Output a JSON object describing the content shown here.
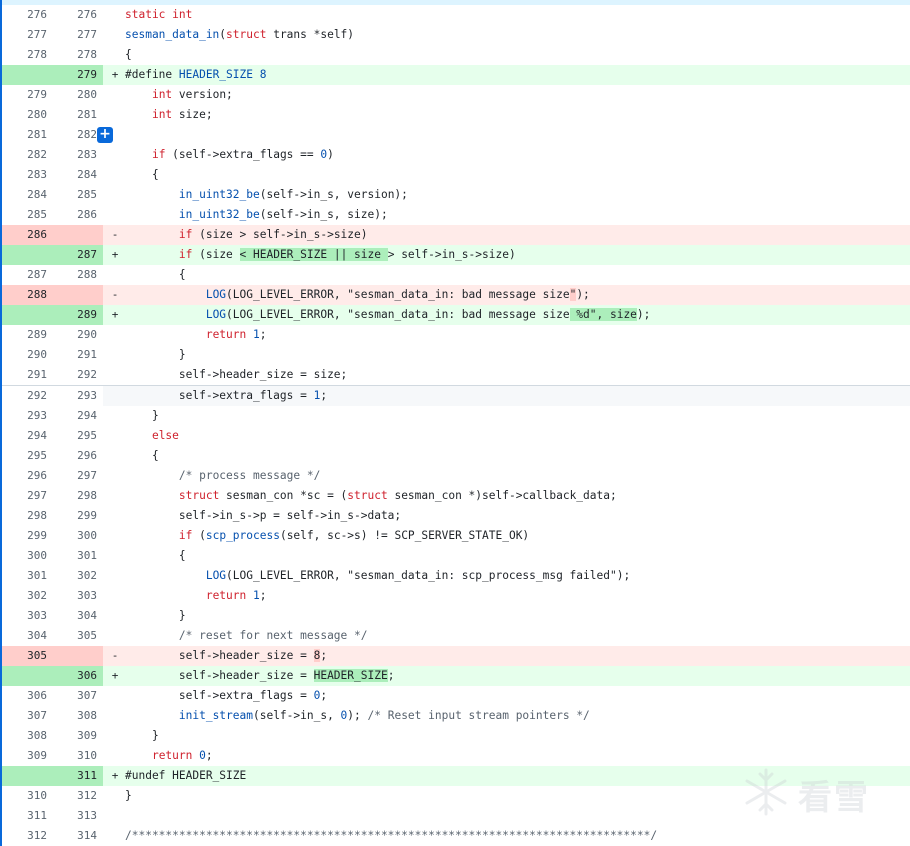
{
  "rows": [
    {
      "old": "276",
      "new": "276",
      "type": "ctx",
      "marker": "",
      "parts": [
        {
          "t": "static int",
          "c": "kw"
        }
      ]
    },
    {
      "old": "277",
      "new": "277",
      "type": "ctx",
      "marker": "",
      "parts": [
        {
          "t": "sesman_data_in",
          "c": "fn"
        },
        {
          "t": "(",
          "c": ""
        },
        {
          "t": "struct",
          "c": "kw"
        },
        {
          "t": " trans *self)",
          "c": ""
        }
      ]
    },
    {
      "old": "278",
      "new": "278",
      "type": "ctx",
      "marker": "",
      "parts": [
        {
          "t": "{",
          "c": ""
        }
      ]
    },
    {
      "old": "",
      "new": "279",
      "type": "add",
      "marker": "+",
      "parts": [
        {
          "t": "#define ",
          "c": ""
        },
        {
          "t": "HEADER_SIZE",
          "c": "fn"
        },
        {
          "t": " ",
          "c": ""
        },
        {
          "t": "8",
          "c": "fn"
        }
      ]
    },
    {
      "old": "279",
      "new": "280",
      "type": "ctx",
      "marker": "",
      "parts": [
        {
          "t": "    ",
          "c": ""
        },
        {
          "t": "int",
          "c": "kw"
        },
        {
          "t": " version;",
          "c": ""
        }
      ]
    },
    {
      "old": "280",
      "new": "281",
      "type": "ctx",
      "marker": "",
      "parts": [
        {
          "t": "    ",
          "c": ""
        },
        {
          "t": "int",
          "c": "kw"
        },
        {
          "t": " size;",
          "c": ""
        }
      ]
    },
    {
      "old": "281",
      "new": "282",
      "type": "ctx",
      "marker": "",
      "expand": true,
      "parts": []
    },
    {
      "old": "282",
      "new": "283",
      "type": "ctx",
      "marker": "",
      "parts": [
        {
          "t": "    ",
          "c": ""
        },
        {
          "t": "if",
          "c": "kw"
        },
        {
          "t": " (self->extra_flags == ",
          "c": ""
        },
        {
          "t": "0",
          "c": "fn"
        },
        {
          "t": ")",
          "c": ""
        }
      ]
    },
    {
      "old": "283",
      "new": "284",
      "type": "ctx",
      "marker": "",
      "parts": [
        {
          "t": "    {",
          "c": ""
        }
      ]
    },
    {
      "old": "284",
      "new": "285",
      "type": "ctx",
      "marker": "",
      "parts": [
        {
          "t": "        ",
          "c": ""
        },
        {
          "t": "in_uint32_be",
          "c": "fn"
        },
        {
          "t": "(self->in_s, version);",
          "c": ""
        }
      ]
    },
    {
      "old": "285",
      "new": "286",
      "type": "ctx",
      "marker": "",
      "parts": [
        {
          "t": "        ",
          "c": ""
        },
        {
          "t": "in_uint32_be",
          "c": "fn"
        },
        {
          "t": "(self->in_s, size);",
          "c": ""
        }
      ]
    },
    {
      "old": "286",
      "new": "",
      "type": "del",
      "marker": "-",
      "parts": [
        {
          "t": "        ",
          "c": ""
        },
        {
          "t": "if",
          "c": "kw"
        },
        {
          "t": " (size > self->in_s->size)",
          "c": ""
        }
      ]
    },
    {
      "old": "",
      "new": "287",
      "type": "add",
      "marker": "+",
      "parts": [
        {
          "t": "        ",
          "c": ""
        },
        {
          "t": "if",
          "c": "kw"
        },
        {
          "t": " (size ",
          "c": ""
        },
        {
          "t": "< HEADER_SIZE || size ",
          "c": "hl-add"
        },
        {
          "t": "> self->in_s->size)",
          "c": ""
        }
      ]
    },
    {
      "old": "287",
      "new": "288",
      "type": "ctx",
      "marker": "",
      "parts": [
        {
          "t": "        {",
          "c": ""
        }
      ]
    },
    {
      "old": "288",
      "new": "",
      "type": "del",
      "marker": "-",
      "parts": [
        {
          "t": "            ",
          "c": ""
        },
        {
          "t": "LOG",
          "c": "fn"
        },
        {
          "t": "(LOG_LEVEL_ERROR, \"sesman_data_in: bad message size",
          "c": ""
        },
        {
          "t": "\"",
          "c": "hl-del"
        },
        {
          "t": ");",
          "c": ""
        }
      ]
    },
    {
      "old": "",
      "new": "289",
      "type": "add",
      "marker": "+",
      "parts": [
        {
          "t": "            ",
          "c": ""
        },
        {
          "t": "LOG",
          "c": "fn"
        },
        {
          "t": "(LOG_LEVEL_ERROR, \"sesman_data_in: bad message size",
          "c": ""
        },
        {
          "t": " %d\", size",
          "c": "hl-add"
        },
        {
          "t": ");",
          "c": ""
        }
      ]
    },
    {
      "old": "289",
      "new": "290",
      "type": "ctx",
      "marker": "",
      "parts": [
        {
          "t": "            ",
          "c": ""
        },
        {
          "t": "return",
          "c": "kw"
        },
        {
          "t": " ",
          "c": ""
        },
        {
          "t": "1",
          "c": "fn"
        },
        {
          "t": ";",
          "c": ""
        }
      ]
    },
    {
      "old": "290",
      "new": "291",
      "type": "ctx",
      "marker": "",
      "parts": [
        {
          "t": "        }",
          "c": ""
        }
      ]
    },
    {
      "old": "291",
      "new": "292",
      "type": "ctx",
      "marker": "",
      "parts": [
        {
          "t": "        self->header_size = size;",
          "c": ""
        }
      ]
    },
    {
      "old": "292",
      "new": "293",
      "type": "gray",
      "sep": true,
      "marker": "",
      "parts": [
        {
          "t": "        self->extra_flags = ",
          "c": ""
        },
        {
          "t": "1",
          "c": "fn"
        },
        {
          "t": ";",
          "c": ""
        }
      ]
    },
    {
      "old": "293",
      "new": "294",
      "type": "ctx",
      "marker": "",
      "parts": [
        {
          "t": "    }",
          "c": ""
        }
      ]
    },
    {
      "old": "294",
      "new": "295",
      "type": "ctx",
      "marker": "",
      "parts": [
        {
          "t": "    ",
          "c": ""
        },
        {
          "t": "else",
          "c": "kw"
        }
      ]
    },
    {
      "old": "295",
      "new": "296",
      "type": "ctx",
      "marker": "",
      "parts": [
        {
          "t": "    {",
          "c": ""
        }
      ]
    },
    {
      "old": "296",
      "new": "297",
      "type": "ctx",
      "marker": "",
      "parts": [
        {
          "t": "        ",
          "c": ""
        },
        {
          "t": "/* process message */",
          "c": "cm"
        }
      ]
    },
    {
      "old": "297",
      "new": "298",
      "type": "ctx",
      "marker": "",
      "parts": [
        {
          "t": "        ",
          "c": ""
        },
        {
          "t": "struct",
          "c": "kw"
        },
        {
          "t": " sesman_con *sc = (",
          "c": ""
        },
        {
          "t": "struct",
          "c": "kw"
        },
        {
          "t": " sesman_con *)self->callback_data;",
          "c": ""
        }
      ]
    },
    {
      "old": "298",
      "new": "299",
      "type": "ctx",
      "marker": "",
      "parts": [
        {
          "t": "        self->in_s->p = self->in_s->data;",
          "c": ""
        }
      ]
    },
    {
      "old": "299",
      "new": "300",
      "type": "ctx",
      "marker": "",
      "parts": [
        {
          "t": "        ",
          "c": ""
        },
        {
          "t": "if",
          "c": "kw"
        },
        {
          "t": " (",
          "c": ""
        },
        {
          "t": "scp_process",
          "c": "fn"
        },
        {
          "t": "(self, sc->s) != SCP_SERVER_STATE_OK)",
          "c": ""
        }
      ]
    },
    {
      "old": "300",
      "new": "301",
      "type": "ctx",
      "marker": "",
      "parts": [
        {
          "t": "        {",
          "c": ""
        }
      ]
    },
    {
      "old": "301",
      "new": "302",
      "type": "ctx",
      "marker": "",
      "parts": [
        {
          "t": "            ",
          "c": ""
        },
        {
          "t": "LOG",
          "c": "fn"
        },
        {
          "t": "(LOG_LEVEL_ERROR, \"sesman_data_in: scp_process_msg failed\");",
          "c": ""
        }
      ]
    },
    {
      "old": "302",
      "new": "303",
      "type": "ctx",
      "sepwhite": true,
      "marker": "",
      "parts": [
        {
          "t": "            ",
          "c": ""
        },
        {
          "t": "return",
          "c": "kw"
        },
        {
          "t": " ",
          "c": ""
        },
        {
          "t": "1",
          "c": "fn"
        },
        {
          "t": ";",
          "c": ""
        }
      ]
    },
    {
      "old": "303",
      "new": "304",
      "type": "ctx",
      "marker": "",
      "parts": [
        {
          "t": "        }",
          "c": ""
        }
      ]
    },
    {
      "old": "304",
      "new": "305",
      "type": "ctx",
      "marker": "",
      "parts": [
        {
          "t": "        ",
          "c": ""
        },
        {
          "t": "/* reset for next message */",
          "c": "cm"
        }
      ]
    },
    {
      "old": "305",
      "new": "",
      "type": "del",
      "marker": "-",
      "parts": [
        {
          "t": "        self->header_size = ",
          "c": ""
        },
        {
          "t": "8",
          "c": "hl-del"
        },
        {
          "t": ";",
          "c": ""
        }
      ]
    },
    {
      "old": "",
      "new": "306",
      "type": "add",
      "marker": "+",
      "parts": [
        {
          "t": "        self->header_size = ",
          "c": ""
        },
        {
          "t": "HEADER_SIZE",
          "c": "hl-add"
        },
        {
          "t": ";",
          "c": ""
        }
      ]
    },
    {
      "old": "306",
      "new": "307",
      "type": "ctx",
      "marker": "",
      "parts": [
        {
          "t": "        self->extra_flags = ",
          "c": ""
        },
        {
          "t": "0",
          "c": "fn"
        },
        {
          "t": ";",
          "c": ""
        }
      ]
    },
    {
      "old": "307",
      "new": "308",
      "type": "ctx",
      "marker": "",
      "parts": [
        {
          "t": "        ",
          "c": ""
        },
        {
          "t": "init_stream",
          "c": "fn"
        },
        {
          "t": "(self->in_s, ",
          "c": ""
        },
        {
          "t": "0",
          "c": "fn"
        },
        {
          "t": "); ",
          "c": ""
        },
        {
          "t": "/* Reset input stream pointers */",
          "c": "cm"
        }
      ]
    },
    {
      "old": "308",
      "new": "309",
      "type": "ctx",
      "marker": "",
      "parts": [
        {
          "t": "    }",
          "c": ""
        }
      ]
    },
    {
      "old": "309",
      "new": "310",
      "type": "ctx",
      "marker": "",
      "parts": [
        {
          "t": "    ",
          "c": ""
        },
        {
          "t": "return",
          "c": "kw"
        },
        {
          "t": " ",
          "c": ""
        },
        {
          "t": "0",
          "c": "fn"
        },
        {
          "t": ";",
          "c": ""
        }
      ]
    },
    {
      "old": "",
      "new": "311",
      "type": "add",
      "marker": "+",
      "parts": [
        {
          "t": "#undef HEADER_SIZE",
          "c": ""
        }
      ]
    },
    {
      "old": "310",
      "new": "312",
      "type": "ctx",
      "marker": "",
      "parts": [
        {
          "t": "}",
          "c": ""
        }
      ]
    },
    {
      "old": "311",
      "new": "313",
      "type": "ctx",
      "marker": "",
      "parts": []
    },
    {
      "old": "312",
      "new": "314",
      "type": "ctx",
      "marker": "",
      "parts": [
        {
          "t": "/*****************************************************************************/",
          "c": "cm"
        }
      ]
    }
  ],
  "expand_label": "+",
  "watermark_text": "看雪",
  "colors": {
    "add_bg": "#e6ffec",
    "add_ln": "#aceebb",
    "del_bg": "#ffebe9",
    "del_ln": "#ffcecb",
    "accent": "#0969da"
  }
}
